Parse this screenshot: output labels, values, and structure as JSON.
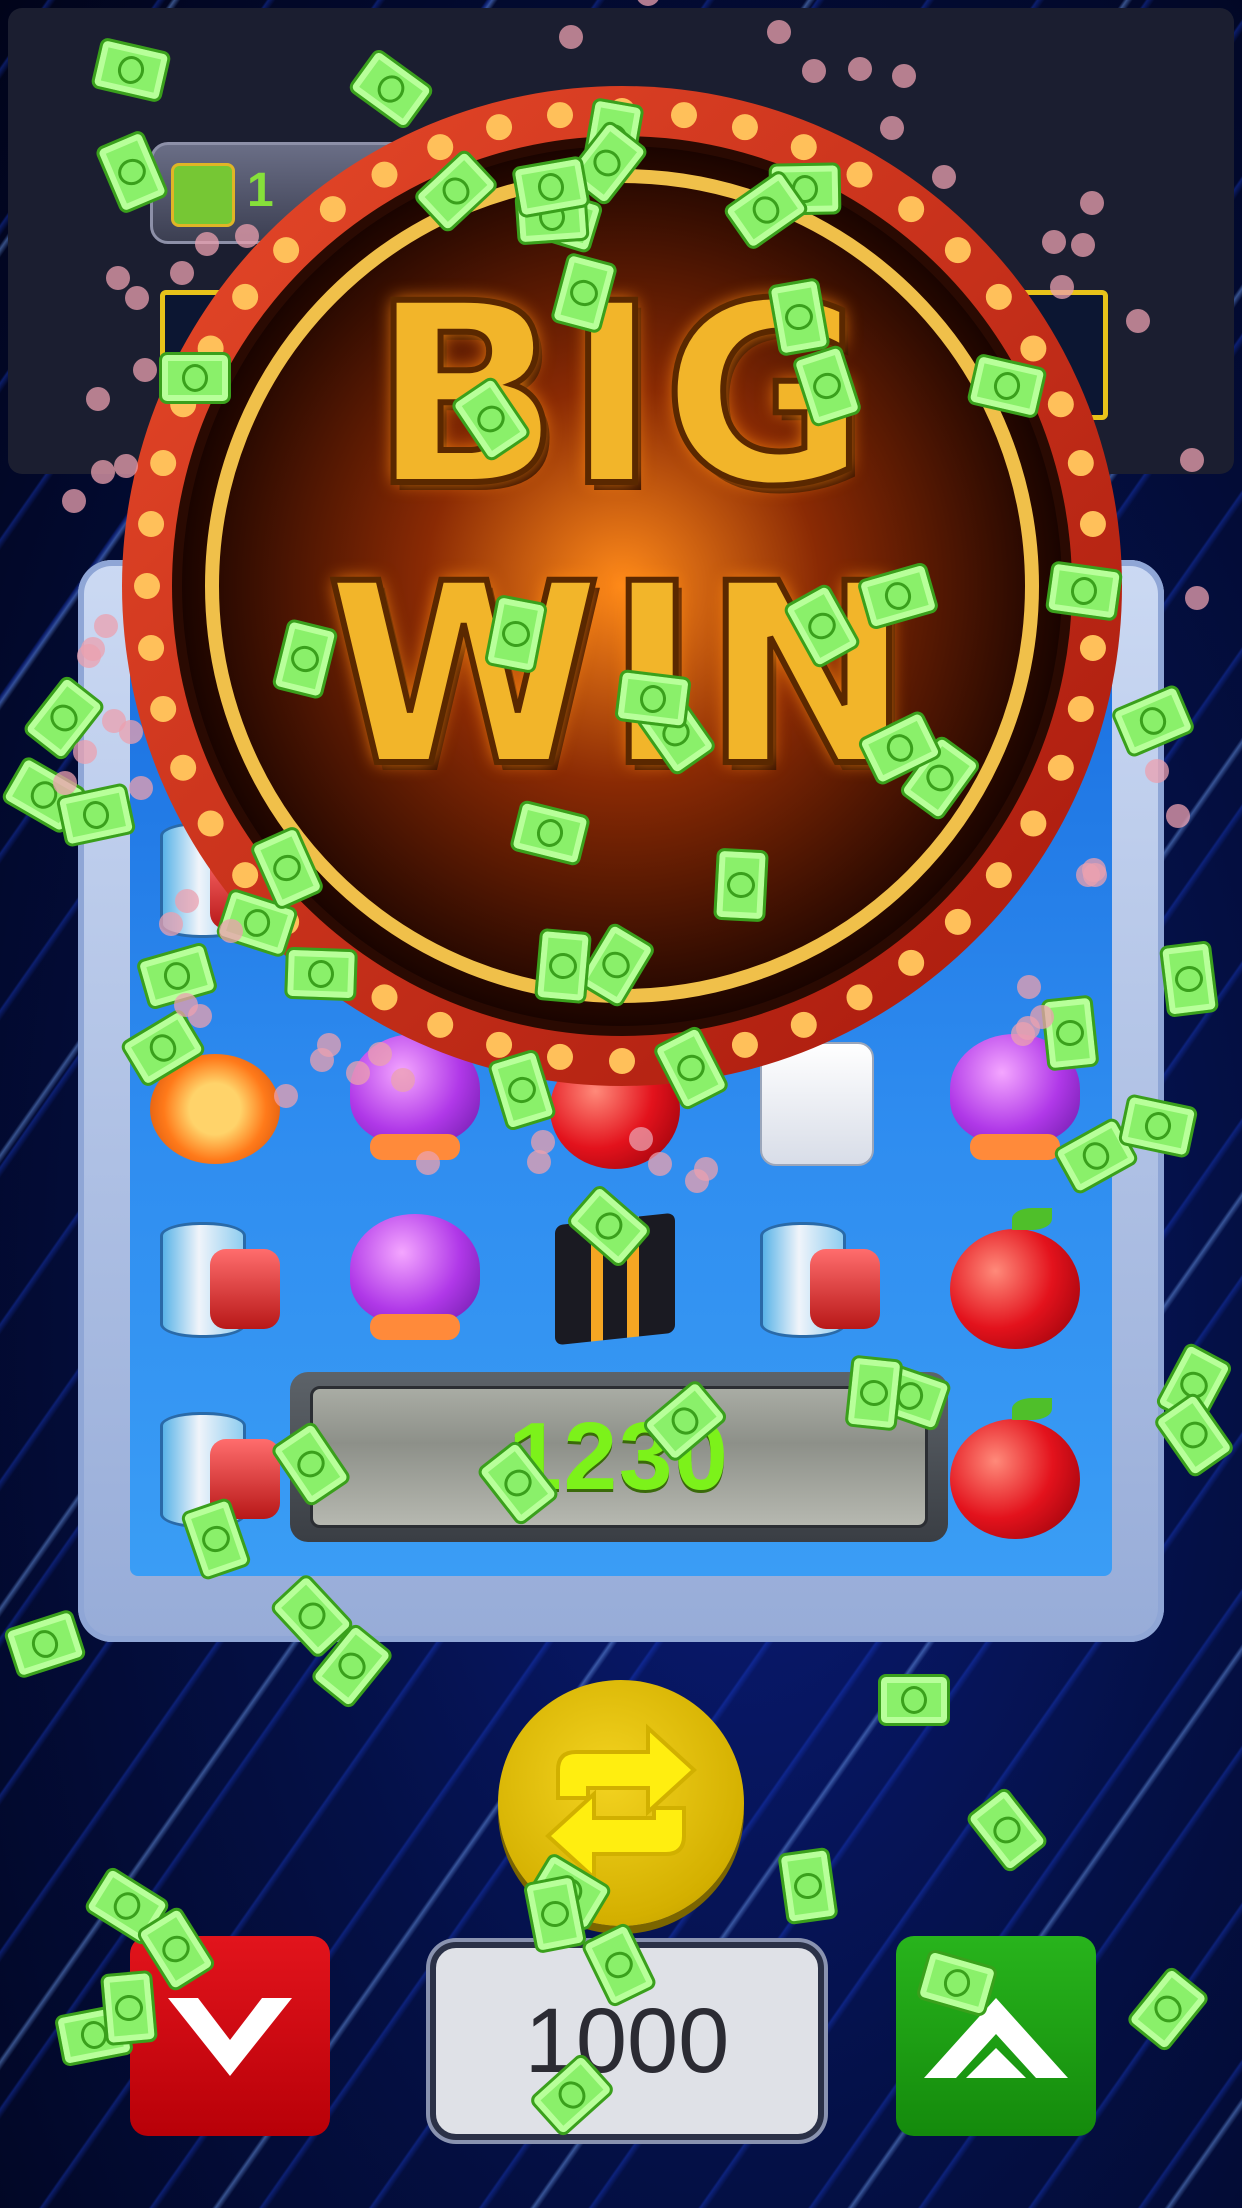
{
  "game": {
    "balance": "1",
    "banner_text_line1": "BIG",
    "banner_text_line2": "WIN",
    "win_amount": "1230",
    "bet_amount": "1000"
  },
  "controls": {
    "spin_icon": "refresh-icon",
    "bet_down_icon": "chevron-down-icon",
    "bet_up_icon": "chevron-up-icon"
  },
  "colors": {
    "win_text": "#7cf21a",
    "spin_button": "#e0c100",
    "bet_down": "#d40e16",
    "bet_up": "#1fa314",
    "banner_gold": "#f2b52a"
  },
  "symbols": [
    "chip",
    "club",
    "apple",
    "dice",
    "club",
    "cup",
    "club",
    "cube",
    "cup",
    "apple",
    "cup",
    "chip",
    "chip",
    "chip",
    "apple"
  ]
}
